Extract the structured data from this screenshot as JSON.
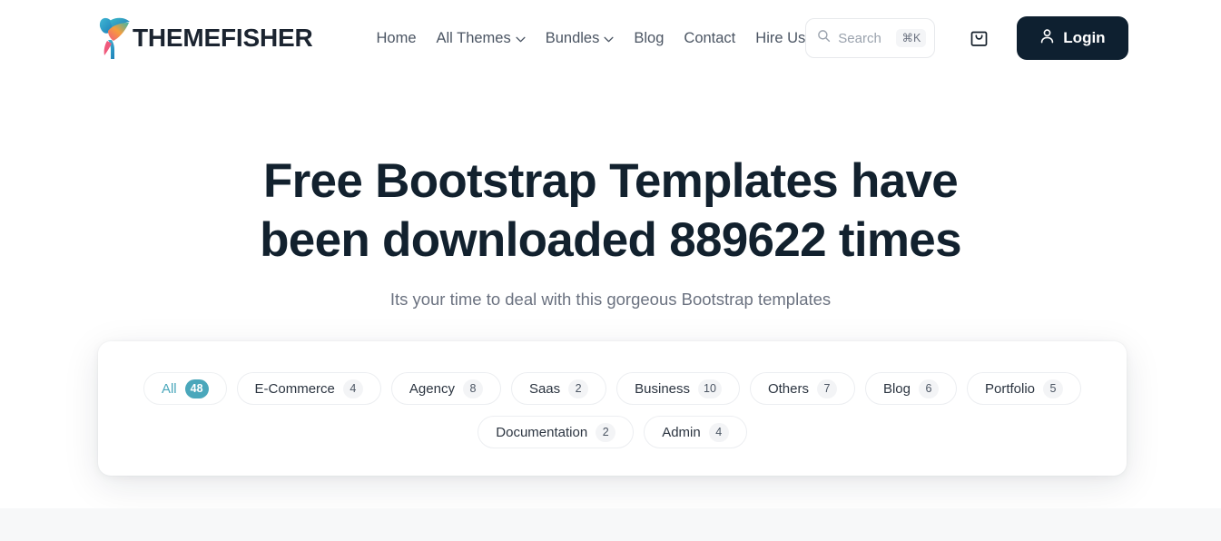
{
  "header": {
    "logo": {
      "text": "THEMEFISHER",
      "icon": "hummingbird-logo-icon"
    },
    "nav": [
      {
        "label": "Home",
        "caret": false
      },
      {
        "label": "All Themes",
        "caret": true
      },
      {
        "label": "Bundles",
        "caret": true
      },
      {
        "label": "Blog",
        "caret": false
      },
      {
        "label": "Contact",
        "caret": false
      },
      {
        "label": "Hire Us",
        "caret": false
      }
    ],
    "search": {
      "placeholder": "Search",
      "shortcut": "⌘K",
      "icon": "search-icon"
    },
    "cart": {
      "icon": "shopping-bag-icon"
    },
    "login": {
      "label": "Login",
      "icon": "user-icon",
      "bg": "#0e2030"
    }
  },
  "hero": {
    "title": "Free Bootstrap Templates have been downloaded 889622 times",
    "download_count": "889622",
    "subtitle": "Its your time to deal with this gorgeous Bootstrap templates"
  },
  "grammarly_widget": {
    "icons": [
      "lightbulb-icon",
      "grammarly-logo-icon"
    ],
    "color": "#a8d8cf"
  },
  "filters": {
    "active": "All",
    "accent": "#4aa7bb",
    "row1": [
      {
        "label": "All",
        "count": "48",
        "active": true
      },
      {
        "label": "E-Commerce",
        "count": "4",
        "active": false
      },
      {
        "label": "Agency",
        "count": "8",
        "active": false
      },
      {
        "label": "Saas",
        "count": "2",
        "active": false
      },
      {
        "label": "Business",
        "count": "10",
        "active": false
      },
      {
        "label": "Others",
        "count": "7",
        "active": false
      },
      {
        "label": "Blog",
        "count": "6",
        "active": false
      },
      {
        "label": "Portfolio",
        "count": "5",
        "active": false
      }
    ],
    "row2": [
      {
        "label": "Documentation",
        "count": "2",
        "active": false
      },
      {
        "label": "Admin",
        "count": "4",
        "active": false
      }
    ]
  }
}
